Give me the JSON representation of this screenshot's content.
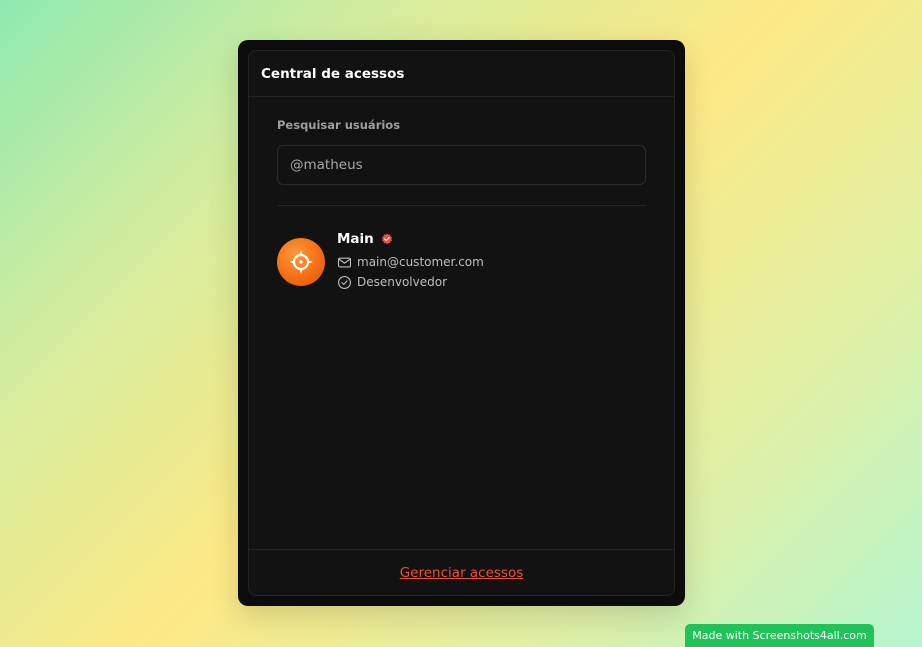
{
  "header": {
    "title": "Central de acessos"
  },
  "search": {
    "label": "Pesquisar usuários",
    "value": "@matheus",
    "placeholder": ""
  },
  "user": {
    "name": "Main",
    "email": "main@customer.com",
    "role": "Desenvolvedor",
    "verified": true,
    "avatar_icon": "compass-icon"
  },
  "footer": {
    "manage_link": "Gerenciar acessos"
  },
  "watermark": {
    "text": "Made with Screenshots4all.com"
  },
  "colors": {
    "accent": "#ef4e3a",
    "avatar": "#f26a10",
    "watermark": "#22c25a"
  }
}
